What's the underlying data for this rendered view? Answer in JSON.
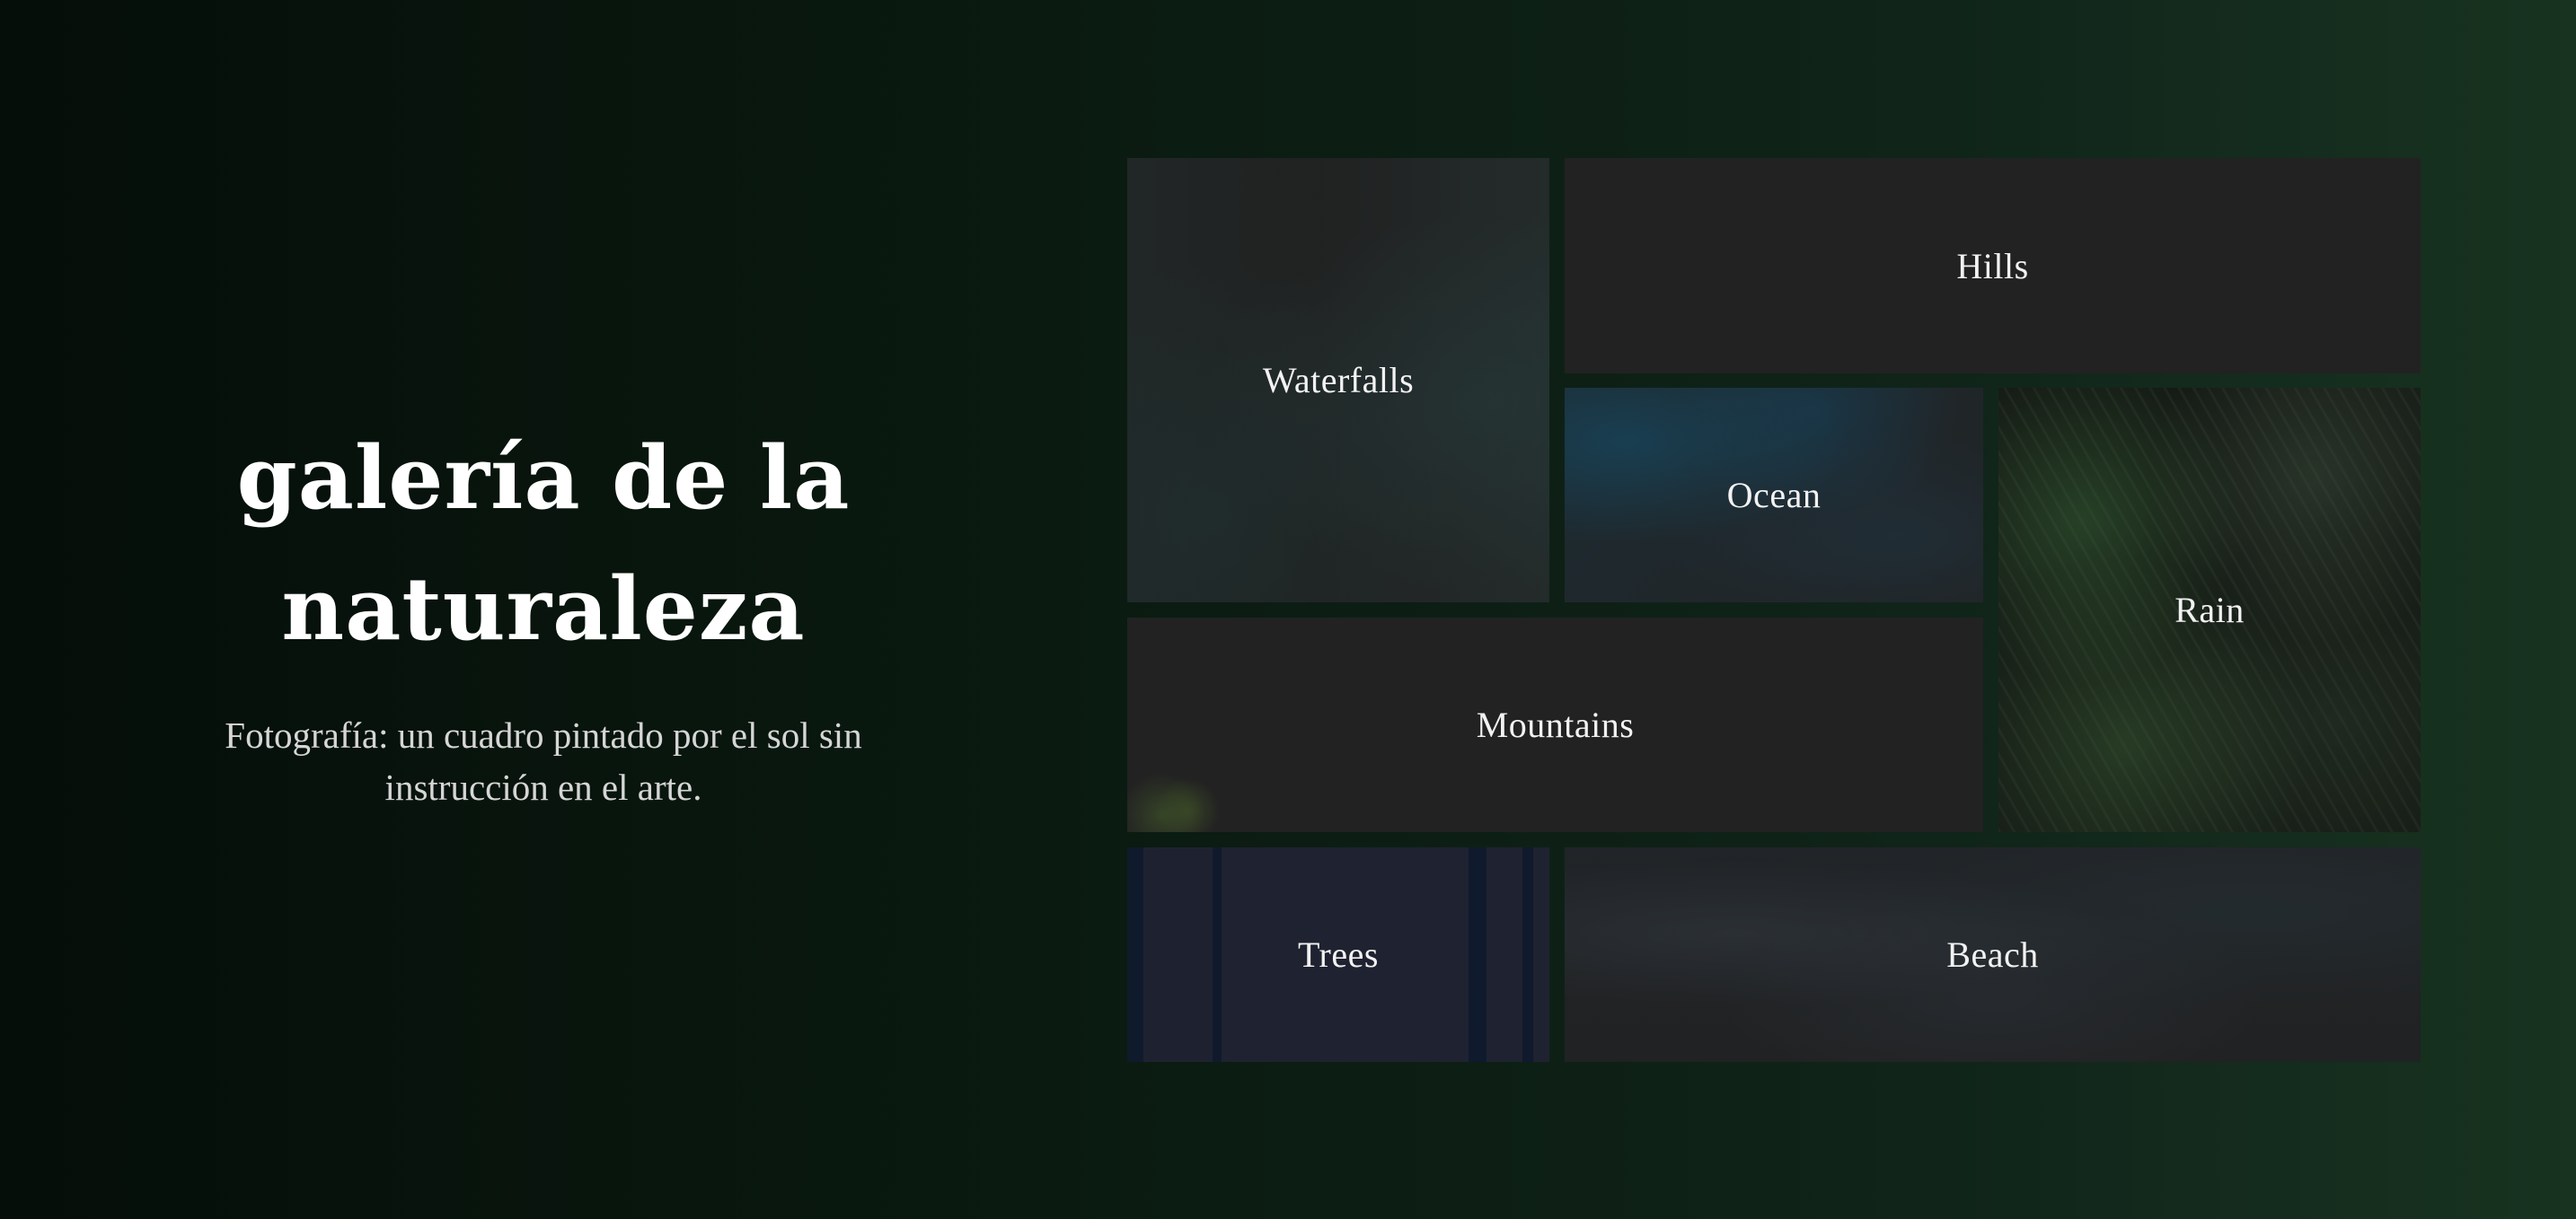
{
  "hero": {
    "title_line1": "galería de la",
    "title_line2": "naturaleza",
    "subtitle_line1": "Fotografía: un cuadro pintado por el sol sin",
    "subtitle_line2": "instrucción en el arte."
  },
  "gallery": {
    "tiles": [
      {
        "id": "waterfalls",
        "label": "Waterfalls"
      },
      {
        "id": "hills",
        "label": "Hills"
      },
      {
        "id": "ocean",
        "label": "Ocean"
      },
      {
        "id": "rain",
        "label": "Rain"
      },
      {
        "id": "mountains",
        "label": "Mountains"
      },
      {
        "id": "trees",
        "label": "Trees"
      },
      {
        "id": "beach",
        "label": "Beach"
      }
    ]
  },
  "colors": {
    "background_start": "#050e09",
    "background_end": "#183320",
    "tile_background": "#222222",
    "text_primary": "#ffffff",
    "text_secondary": "#d6d6d6"
  }
}
